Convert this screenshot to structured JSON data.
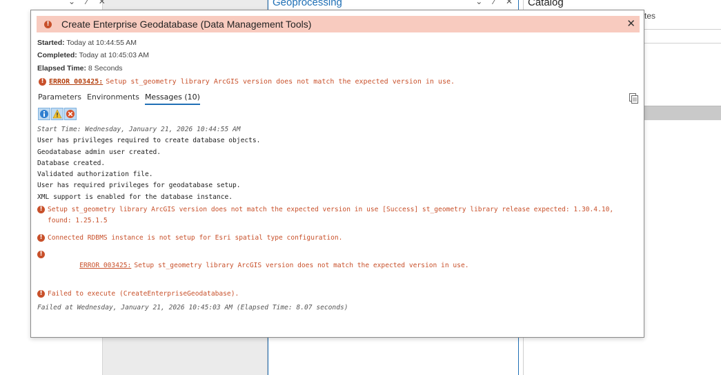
{
  "background": {
    "gp_pane_title": "Geoprocessing",
    "catalog_pane_title": "Catalog",
    "partial_text": "tes",
    "pane_controls": "⌄ ⁄ ✕"
  },
  "dialog": {
    "title": "Create Enterprise Geodatabase (Data Management Tools)",
    "close_symbol": "✕",
    "started_label": "Started:",
    "started_value": "Today at 10:44:55 AM",
    "completed_label": "Completed:",
    "completed_value": "Today at 10:45:03 AM",
    "elapsed_label": "Elapsed Time:",
    "elapsed_value": "8 Seconds",
    "summary_error": {
      "code": "ERROR 003425:",
      "text": "Setup st_geometry library ArcGIS version does not match the expected version in use."
    },
    "tabs": [
      {
        "label": "Parameters",
        "active": false
      },
      {
        "label": "Environments",
        "active": false
      },
      {
        "label": "Messages (10)",
        "active": true
      }
    ],
    "messages": [
      {
        "type": "info-ital",
        "text": "Start Time: Wednesday, January 21, 2026 10:44:55 AM"
      },
      {
        "type": "info",
        "text": "User has privileges required to create database objects."
      },
      {
        "type": "info",
        "text": "Geodatabase admin user created."
      },
      {
        "type": "info",
        "text": "Database created."
      },
      {
        "type": "info",
        "text": "Validated authorization file."
      },
      {
        "type": "info",
        "text": "User has required privileges for geodatabase setup."
      },
      {
        "type": "info",
        "text": "XML support is enabled for the database instance."
      },
      {
        "type": "error",
        "text": "Setup st_geometry library ArcGIS version does not match the expected version in use [Success] st_geometry library release expected: 1.30.4.10, found: 1.25.1.5"
      },
      {
        "type": "error",
        "text": "Connected RDBMS instance is not setup for Esri spatial type configuration."
      },
      {
        "type": "error",
        "code": "ERROR 003425:",
        "text": "Setup st_geometry library ArcGIS version does not match the expected version in use."
      },
      {
        "type": "error",
        "text": "Failed to execute (CreateEnterpriseGeodatabase)."
      },
      {
        "type": "info-ital",
        "text": "Failed at Wednesday, January 21, 2026 10:45:03 AM (Elapsed Time: 8.07 seconds)"
      }
    ]
  },
  "icons": {
    "error": "error-circle-icon",
    "info_filter": "info-icon",
    "warning_filter": "warning-icon",
    "error_filter": "error-x-icon",
    "copy": "copy-icon"
  },
  "colors": {
    "banner_bg": "#f8cbbf",
    "error_text": "#c8502a",
    "accent": "#1f6fb5"
  }
}
